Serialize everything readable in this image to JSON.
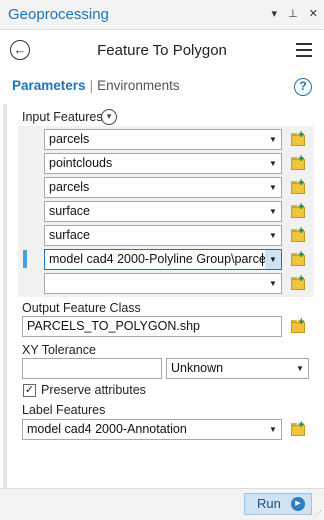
{
  "window": {
    "title": "Geoprocessing",
    "controls": [
      "▾",
      "⊥",
      "✕"
    ]
  },
  "tool": {
    "title": "Feature To Polygon"
  },
  "tabs": {
    "parameters": "Parameters",
    "separator": "|",
    "environments": "Environments"
  },
  "help_icon": "?",
  "input_features": {
    "label": "Input Features",
    "items": [
      "parcels",
      "pointclouds",
      "parcels",
      "surface",
      "surface",
      "model cad4 2000-Polyline Group\\parcels",
      ""
    ]
  },
  "output_feature_class": {
    "label": "Output Feature Class",
    "value": "PARCELS_TO_POLYGON.shp"
  },
  "xy_tolerance": {
    "label": "XY Tolerance",
    "value": "",
    "unit": "Unknown"
  },
  "preserve_attributes": {
    "label": "Preserve attributes",
    "checked": true,
    "mark": "✓"
  },
  "label_features": {
    "label": "Label Features",
    "value": "model cad4 2000-Annotation"
  },
  "run_button": {
    "label": "Run"
  },
  "colors": {
    "accent": "#1f73b7",
    "run_bg": "#cfe3f4",
    "folder": "#f0c33c"
  },
  "icons": [
    "back-arrow-icon",
    "menu-icon",
    "help-icon",
    "chevron-down-icon",
    "dropdown-arrow-icon",
    "add-folder-icon",
    "play-icon"
  ]
}
